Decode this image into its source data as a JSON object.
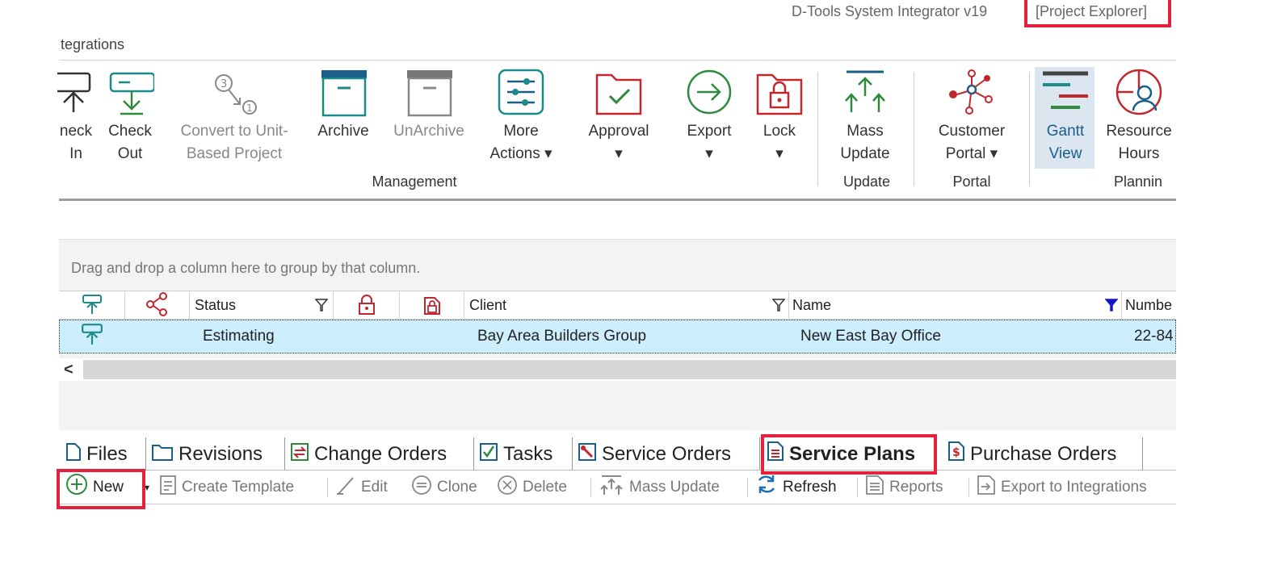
{
  "window": {
    "app_title": "D-Tools System Integrator v19",
    "mode": "[Project Explorer]"
  },
  "menu": {
    "partial_tab": "tegrations"
  },
  "ribbon": {
    "buttons": {
      "check_in": {
        "line1": "neck",
        "line2": "In"
      },
      "check_out": {
        "line1": "Check",
        "line2": "Out"
      },
      "convert": {
        "line1": "Convert to Unit-",
        "line2": "Based Project"
      },
      "archive": {
        "line1": "Archive"
      },
      "unarchive": {
        "line1": "UnArchive"
      },
      "more_actions": {
        "line1": "More",
        "line2": "Actions ▾"
      },
      "approval": {
        "line1": "Approval",
        "line2": "▾"
      },
      "export": {
        "line1": "Export",
        "line2": "▾"
      },
      "lock": {
        "line1": "Lock",
        "line2": "▾"
      },
      "mass_update": {
        "line1": "Mass",
        "line2": "Update"
      },
      "customer_portal": {
        "line1": "Customer",
        "line2": "Portal ▾"
      },
      "gantt_view": {
        "line1": "Gantt",
        "line2": "View"
      },
      "resource_hours": {
        "line1": "Resource",
        "line2": "Hours"
      }
    },
    "groups": {
      "management": "Management",
      "update": "Update",
      "portal": "Portal",
      "planning": "Plannin"
    }
  },
  "grid": {
    "drag_hint": "Drag and drop a column here to group by that column.",
    "columns": {
      "status": "Status",
      "client": "Client",
      "name": "Name",
      "number": "Numbe"
    },
    "rows": [
      {
        "status": "Estimating",
        "client": "Bay Area Builders Group",
        "name": "New East Bay Office",
        "number": "22-84"
      }
    ],
    "scroll_left": "<"
  },
  "tabs": {
    "files": "Files",
    "revisions": "Revisions",
    "change_orders": "Change Orders",
    "tasks": "Tasks",
    "service_orders": "Service Orders",
    "service_plans": "Service Plans",
    "purchase_orders": "Purchase Orders"
  },
  "toolbar": {
    "new": "New",
    "create_template": "Create Template",
    "edit": "Edit",
    "clone": "Clone",
    "delete": "Delete",
    "mass_update": "Mass Update",
    "refresh": "Refresh",
    "reports": "Reports",
    "export_integrations": "Export to Integrations"
  },
  "colors": {
    "highlight_red": "#e5213d",
    "teal": "#1a8a8a",
    "dark_red": "#c0282d",
    "green": "#2e8b3e",
    "selected_row": "#cdeefd"
  }
}
